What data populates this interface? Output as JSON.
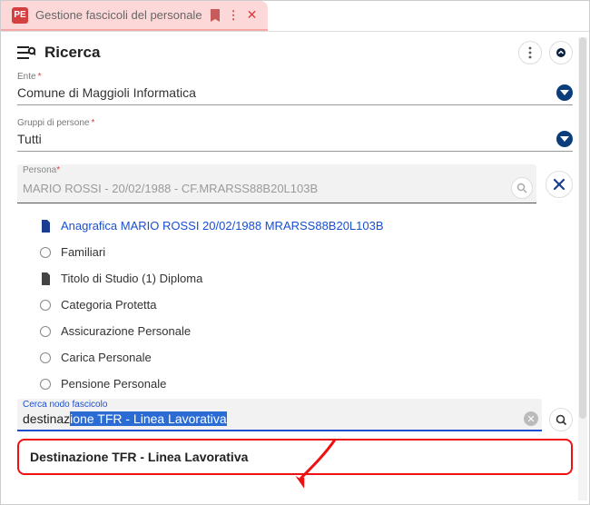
{
  "tab": {
    "app_badge": "PE",
    "title": "Gestione fascicoli del personale"
  },
  "header": {
    "title": "Ricerca"
  },
  "fields": {
    "ente": {
      "label": "Ente",
      "required": "*",
      "value": "Comune di Maggioli Informatica"
    },
    "gruppi": {
      "label": "Gruppi di persone",
      "required": "*",
      "value": "Tutti"
    },
    "persona": {
      "label": "Persona",
      "required": "*",
      "value": "MARIO ROSSI - 20/02/1988 - CF.MRARSS88B20L103B"
    }
  },
  "tree": [
    {
      "icon": "doc",
      "label": "Anagrafica MARIO ROSSI 20/02/1988 MRARSS88B20L103B",
      "link": true
    },
    {
      "icon": "radio",
      "label": "Familiari"
    },
    {
      "icon": "file",
      "label": "Titolo di Studio (1) Diploma"
    },
    {
      "icon": "radio",
      "label": "Categoria Protetta"
    },
    {
      "icon": "radio",
      "label": "Assicurazione Personale"
    },
    {
      "icon": "radio",
      "label": "Carica Personale"
    },
    {
      "icon": "radio",
      "label": "Pensione Personale"
    }
  ],
  "search_node": {
    "label": "Cerca nodo fascicolo",
    "prefix": "destinaz",
    "highlighted": "ione TFR  - Linea Lavorativa"
  },
  "suggestion": {
    "label": "Destinazione TFR - Linea Lavorativa"
  }
}
